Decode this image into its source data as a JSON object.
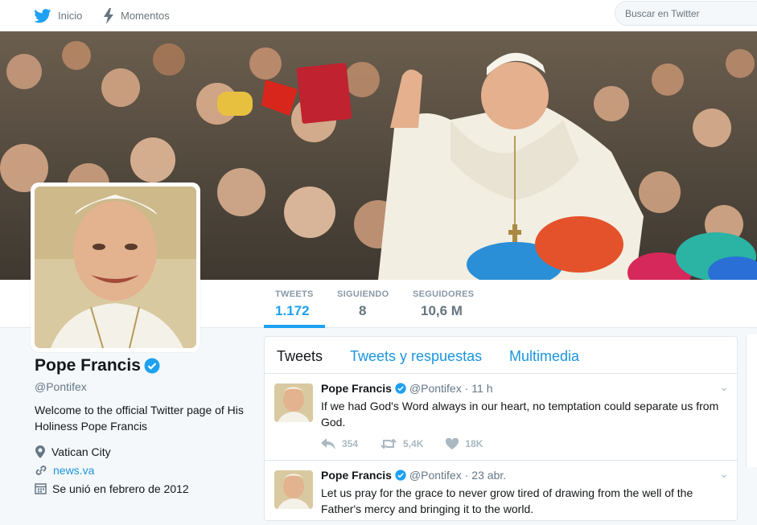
{
  "topbar": {
    "home_label": "Inicio",
    "moments_label": "Momentos",
    "search_placeholder": "Buscar en Twitter"
  },
  "stats": [
    {
      "label": "TWEETS",
      "value": "1.172"
    },
    {
      "label": "SIGUIENDO",
      "value": "8"
    },
    {
      "label": "SEGUIDORES",
      "value": "10,6 M"
    }
  ],
  "profile": {
    "name": "Pope Francis",
    "handle": "@Pontifex",
    "bio": "Welcome to the official Twitter page of His Holiness Pope Francis",
    "location": "Vatican City",
    "website": "news.va",
    "joined": "Se unió en febrero de 2012"
  },
  "tabs": [
    "Tweets",
    "Tweets y respuestas",
    "Multimedia"
  ],
  "tweets": [
    {
      "name": "Pope Francis",
      "handle": "@Pontifex",
      "time": "· 11 h",
      "text": "If we had God's Word always in our heart, no temptation could separate us from God.",
      "replies": "354",
      "retweets": "5,4K",
      "likes": "18K"
    },
    {
      "name": "Pope Francis",
      "handle": "@Pontifex",
      "time": "· 23 abr.",
      "text": "Let us pray for the grace to never grow tired of drawing from the well of the Father's mercy and bringing it to the world."
    }
  ],
  "colors": {
    "accent": "#1da1f2",
    "verified": "#1da1f2",
    "link": "#1b95e0"
  }
}
